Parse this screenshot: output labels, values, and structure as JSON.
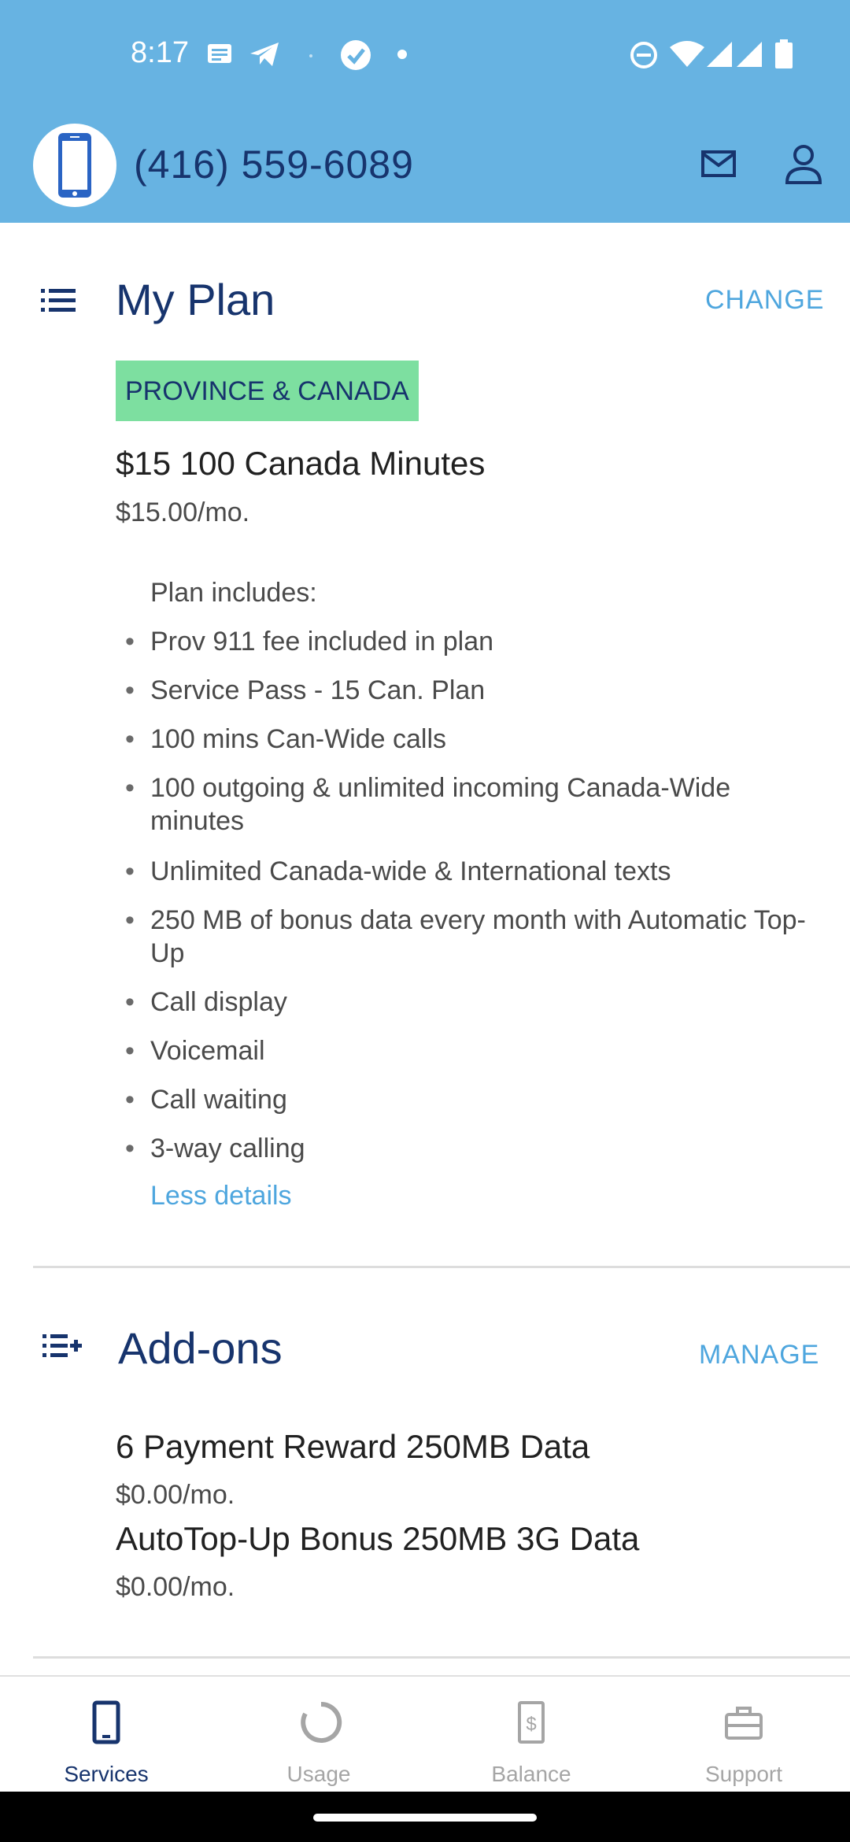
{
  "status_bar": {
    "time": "8:17",
    "icons": [
      "message-icon",
      "telegram-icon",
      "check-circle-icon",
      "dot-icon",
      "dnd-icon",
      "wifi-icon",
      "signal-icon",
      "signal-icon",
      "battery-icon"
    ]
  },
  "header": {
    "phone_number": "(416) 559-6089",
    "icons": [
      "phone-avatar-icon",
      "mail-icon",
      "user-icon"
    ]
  },
  "my_plan": {
    "title": "My Plan",
    "action": "CHANGE",
    "badge": "PROVINCE & CANADA",
    "plan_name": "$15 100 Canada Minutes",
    "price": "$15.00/mo.",
    "includes_label": "Plan includes:",
    "features": [
      "Prov 911 fee included in plan",
      "Service Pass - 15 Can. Plan",
      "100 mins Can-Wide calls",
      "100 outgoing & unlimited incoming Canada-Wide minutes",
      "Unlimited Canada-wide & International texts",
      "250 MB of bonus data every month with Automatic Top-Up",
      "Call display",
      "Voicemail",
      "Call waiting",
      "3-way calling"
    ],
    "less_details": "Less details"
  },
  "addons": {
    "title": "Add-ons",
    "action": "MANAGE",
    "items": [
      {
        "name": "6 Payment Reward 250MB Data",
        "price": "$0.00/mo."
      },
      {
        "name": "AutoTop-Up Bonus 250MB 3G Data",
        "price": "$0.00/mo."
      }
    ]
  },
  "bottom_nav": {
    "items": [
      {
        "label": "Services",
        "icon": "phone-icon",
        "active": true
      },
      {
        "label": "Usage",
        "icon": "usage-ring-icon",
        "active": false
      },
      {
        "label": "Balance",
        "icon": "balance-icon",
        "active": false
      },
      {
        "label": "Support",
        "icon": "briefcase-icon",
        "active": false
      }
    ]
  },
  "colors": {
    "header_bg": "#67b3e2",
    "primary_text": "#17346d",
    "link": "#4ea6de",
    "badge_bg": "#7ddfa0"
  }
}
